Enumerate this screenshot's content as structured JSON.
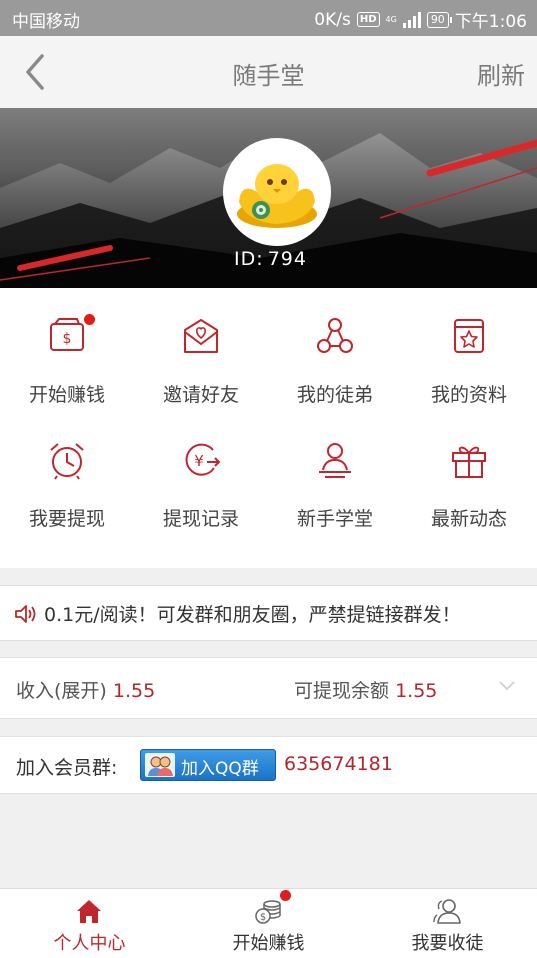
{
  "status_bar": {
    "carrier": "中国移动",
    "speed": "0K/s",
    "hd": "HD",
    "network": "4G",
    "battery": "90",
    "time": "下午1:06"
  },
  "header": {
    "title": "随手堂",
    "refresh": "刷新",
    "back_icon": "chevron-left-icon"
  },
  "profile": {
    "id_label": "ID:",
    "id_value": "794",
    "avatar_icon": "gold-ingot-mascot"
  },
  "menu": [
    {
      "label": "开始赚钱",
      "icon": "wallet-dollar-icon",
      "badge": true
    },
    {
      "label": "邀请好友",
      "icon": "envelope-heart-icon",
      "badge": false
    },
    {
      "label": "我的徒弟",
      "icon": "network-nodes-icon",
      "badge": false
    },
    {
      "label": "我的资料",
      "icon": "profile-star-icon",
      "badge": false
    },
    {
      "label": "我要提现",
      "icon": "alarm-clock-icon",
      "badge": false
    },
    {
      "label": "提现记录",
      "icon": "yuan-transfer-icon",
      "badge": false
    },
    {
      "label": "新手学堂",
      "icon": "person-podium-icon",
      "badge": false
    },
    {
      "label": "最新动态",
      "icon": "gift-icon",
      "badge": false
    }
  ],
  "notice": {
    "icon": "speaker-icon",
    "text": "0.1元/阅读！可发群和朋友圈，严禁提链接群发！"
  },
  "income": {
    "income_label": "收入(展开)",
    "income_value": "1.55",
    "balance_label": "可提现余额",
    "balance_value": "1.55",
    "expand_icon": "chevron-down-icon"
  },
  "member_group": {
    "label": "加入会员群:",
    "button": "加入QQ群",
    "number": "635674181"
  },
  "tabbar": [
    {
      "label": "个人中心",
      "icon": "home-icon",
      "active": true,
      "badge": false
    },
    {
      "label": "开始赚钱",
      "icon": "coins-icon",
      "active": false,
      "badge": true
    },
    {
      "label": "我要收徒",
      "icon": "users-icon",
      "active": false,
      "badge": false
    }
  ],
  "colors": {
    "accent": "#c0262c",
    "badge": "#e01b1b",
    "qq_button": "#2a86d8",
    "banner_stripe": "#d9282c"
  }
}
